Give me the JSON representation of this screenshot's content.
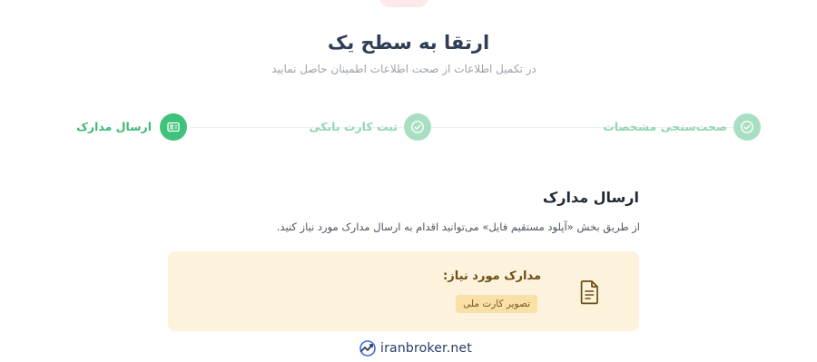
{
  "header": {
    "title": "ارتقا به سطح یک",
    "subtitle": "در تکمیل اطلاعات از صحت اطلاعات اطمینان حاصل نمایید"
  },
  "stepper": {
    "steps": [
      {
        "label": "صحت‌سنجی مشخصات",
        "state": "done",
        "icon": "check-circle-icon"
      },
      {
        "label": "ثبت کارت بانکی",
        "state": "done",
        "icon": "check-circle-icon"
      },
      {
        "label": "ارسال مدارک",
        "state": "active",
        "icon": "id-card-icon"
      }
    ]
  },
  "section": {
    "title": "ارسال مدارک",
    "description": "از طریق بخش «آپلود مستقیم فایل» می‌توانید اقدام به ارسال مدارک مورد نیاز کنید."
  },
  "required_docs": {
    "heading": "مدارک مورد نیاز:",
    "items": [
      "تصویر کارت ملی"
    ],
    "icon": "document-icon"
  },
  "footer": {
    "brand": "iranbroker.net",
    "icon": "chart-logo-icon"
  },
  "colors": {
    "accent_green": "#3fc27b",
    "done_green": "#a8dfc3",
    "card_bg": "#fdf2dc",
    "chip_bg": "#f9dfa8"
  }
}
